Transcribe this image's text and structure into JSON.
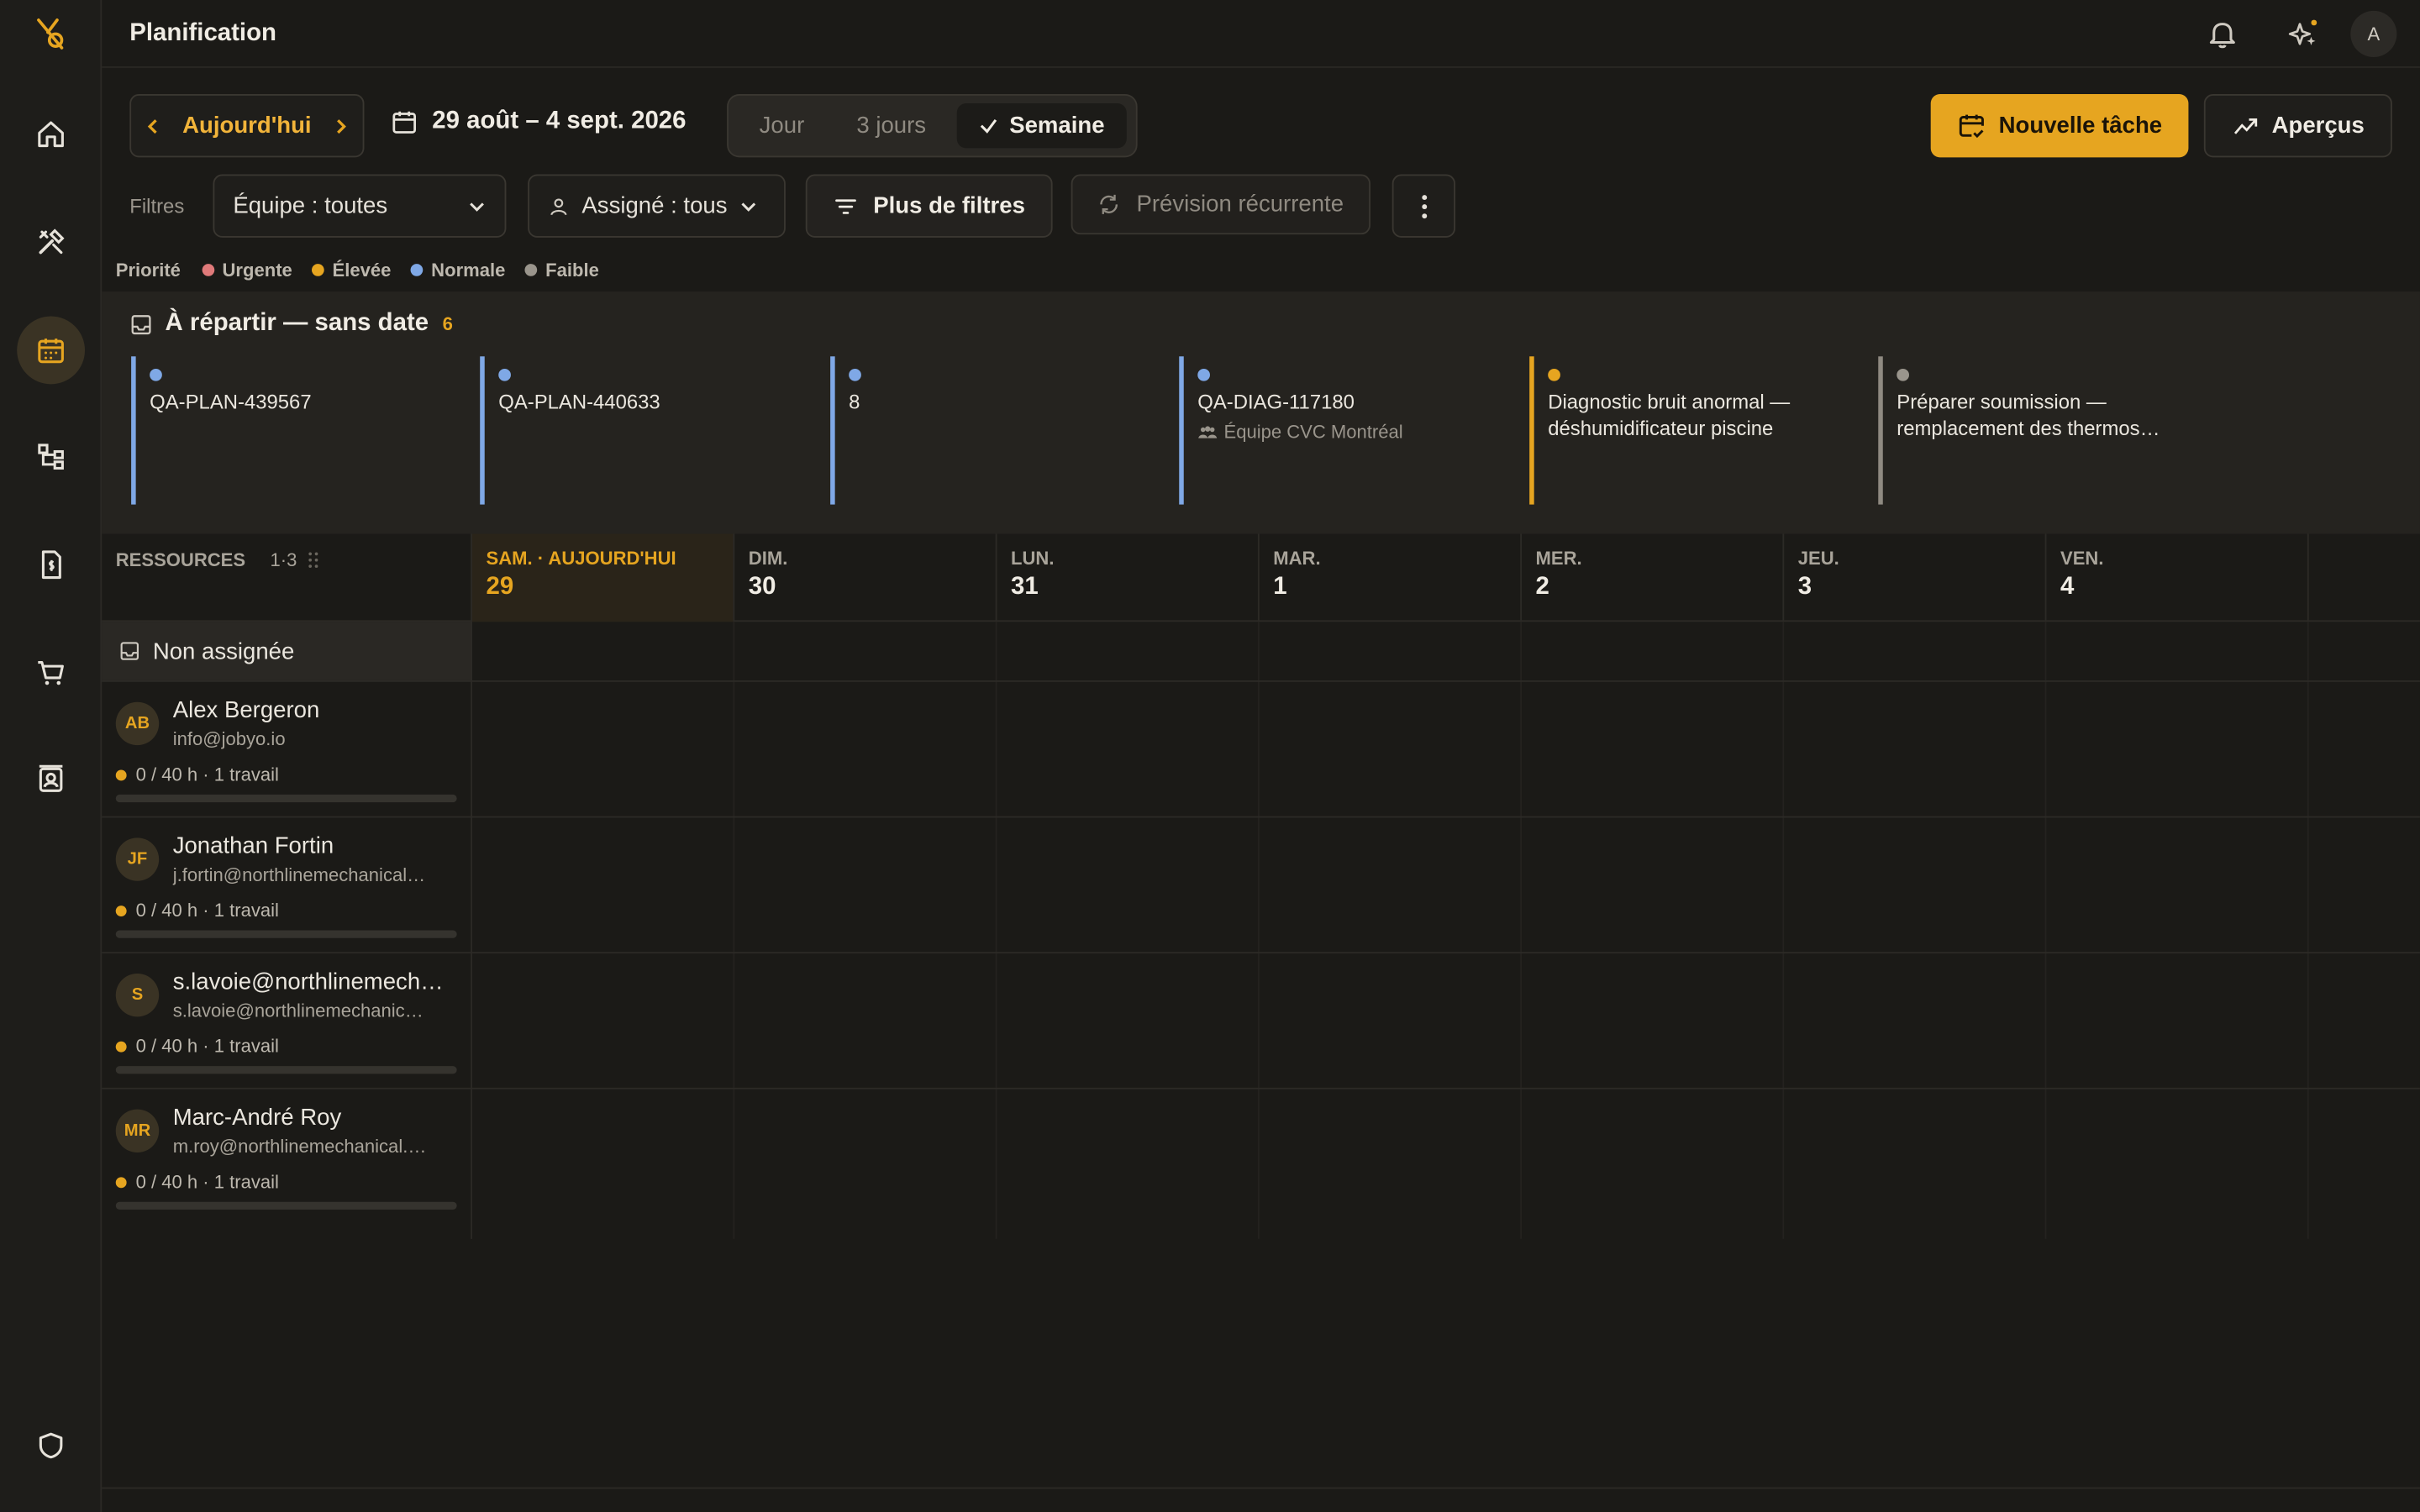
{
  "app": {
    "title": "Planification",
    "user_initial": "A"
  },
  "sidebar": {
    "items": [
      {
        "icon": "home-icon",
        "active": false
      },
      {
        "icon": "tools-icon",
        "active": false
      },
      {
        "icon": "calendar-icon",
        "active": true
      },
      {
        "icon": "hierarchy-icon",
        "active": false
      },
      {
        "icon": "invoice-icon",
        "active": false
      },
      {
        "icon": "cart-icon",
        "active": false
      },
      {
        "icon": "contacts-icon",
        "active": false
      }
    ],
    "bottom_icon": "shield-icon"
  },
  "toolbar": {
    "today_label": "Aujourd'hui",
    "range_label": "29 août – 4 sept. 2026",
    "views": [
      "Jour",
      "3 jours",
      "Semaine"
    ],
    "selected_view": "Semaine",
    "new_task_label": "Nouvelle tâche",
    "insights_label": "Aperçus"
  },
  "filters": {
    "label": "Filtres",
    "team": "Équipe : toutes",
    "assignee": "Assigné : tous",
    "more_filters": "Plus de filtres",
    "recurring_forecast": "Prévision récurrente"
  },
  "priority_legend": {
    "label": "Priorité",
    "items": [
      {
        "label": "Urgente",
        "color": "#e07a7a"
      },
      {
        "label": "Élevée",
        "color": "#e6a520"
      },
      {
        "label": "Normale",
        "color": "#7fa8e6"
      },
      {
        "label": "Faible",
        "color": "#9a958c"
      }
    ]
  },
  "unscheduled": {
    "title": "À répartir — sans date",
    "count": "6",
    "cards": [
      {
        "title": "QA-PLAN-439567",
        "subtitle": "",
        "color": "#7fa8e6"
      },
      {
        "title": "QA-PLAN-440633",
        "subtitle": "",
        "color": "#7fa8e6"
      },
      {
        "title": "8",
        "subtitle": "",
        "color": "#7fa8e6"
      },
      {
        "title": "QA-DIAG-117180",
        "subtitle": "Équipe CVC Montréal",
        "color": "#7fa8e6"
      },
      {
        "title": "Diagnostic bruit anormal — déshumidificateur piscine",
        "subtitle": "",
        "color": "#e6a520"
      },
      {
        "title": "Préparer soumission — remplacement des thermos…",
        "subtitle": "",
        "color": "#9a958c"
      }
    ]
  },
  "grid": {
    "resources_label": "RESSOURCES",
    "resources_range": "1·3",
    "days": [
      {
        "name": "SAM. · AUJOURD'HUI",
        "num": "29",
        "today": true
      },
      {
        "name": "DIM.",
        "num": "30",
        "today": false
      },
      {
        "name": "LUN.",
        "num": "31",
        "today": false
      },
      {
        "name": "MAR.",
        "num": "1",
        "today": false
      },
      {
        "name": "MER.",
        "num": "2",
        "today": false
      },
      {
        "name": "JEU.",
        "num": "3",
        "today": false
      },
      {
        "name": "VEN.",
        "num": "4",
        "today": false
      }
    ],
    "unassigned_label": "Non assignée",
    "resources": [
      {
        "initials": "AB",
        "name": "Alex Bergeron",
        "email": "info@jobyo.io",
        "load": "0 / 40 h · 1 travail",
        "load_fraction": 0
      },
      {
        "initials": "JF",
        "name": "Jonathan Fortin",
        "email": "j.fortin@northlinemechanical…",
        "load": "0 / 40 h · 1 travail",
        "load_fraction": 0
      },
      {
        "initials": "S",
        "name": "s.lavoie@northlinemech…",
        "email": "s.lavoie@northlinemechanic…",
        "load": "0 / 40 h · 1 travail",
        "load_fraction": 0
      },
      {
        "initials": "MR",
        "name": "Marc-André Roy",
        "email": "m.roy@northlinemechanical.…",
        "load": "0 / 40 h · 1 travail",
        "load_fraction": 0
      }
    ]
  },
  "colors": {
    "accent": "#e6a520",
    "background": "#1b1a17"
  }
}
